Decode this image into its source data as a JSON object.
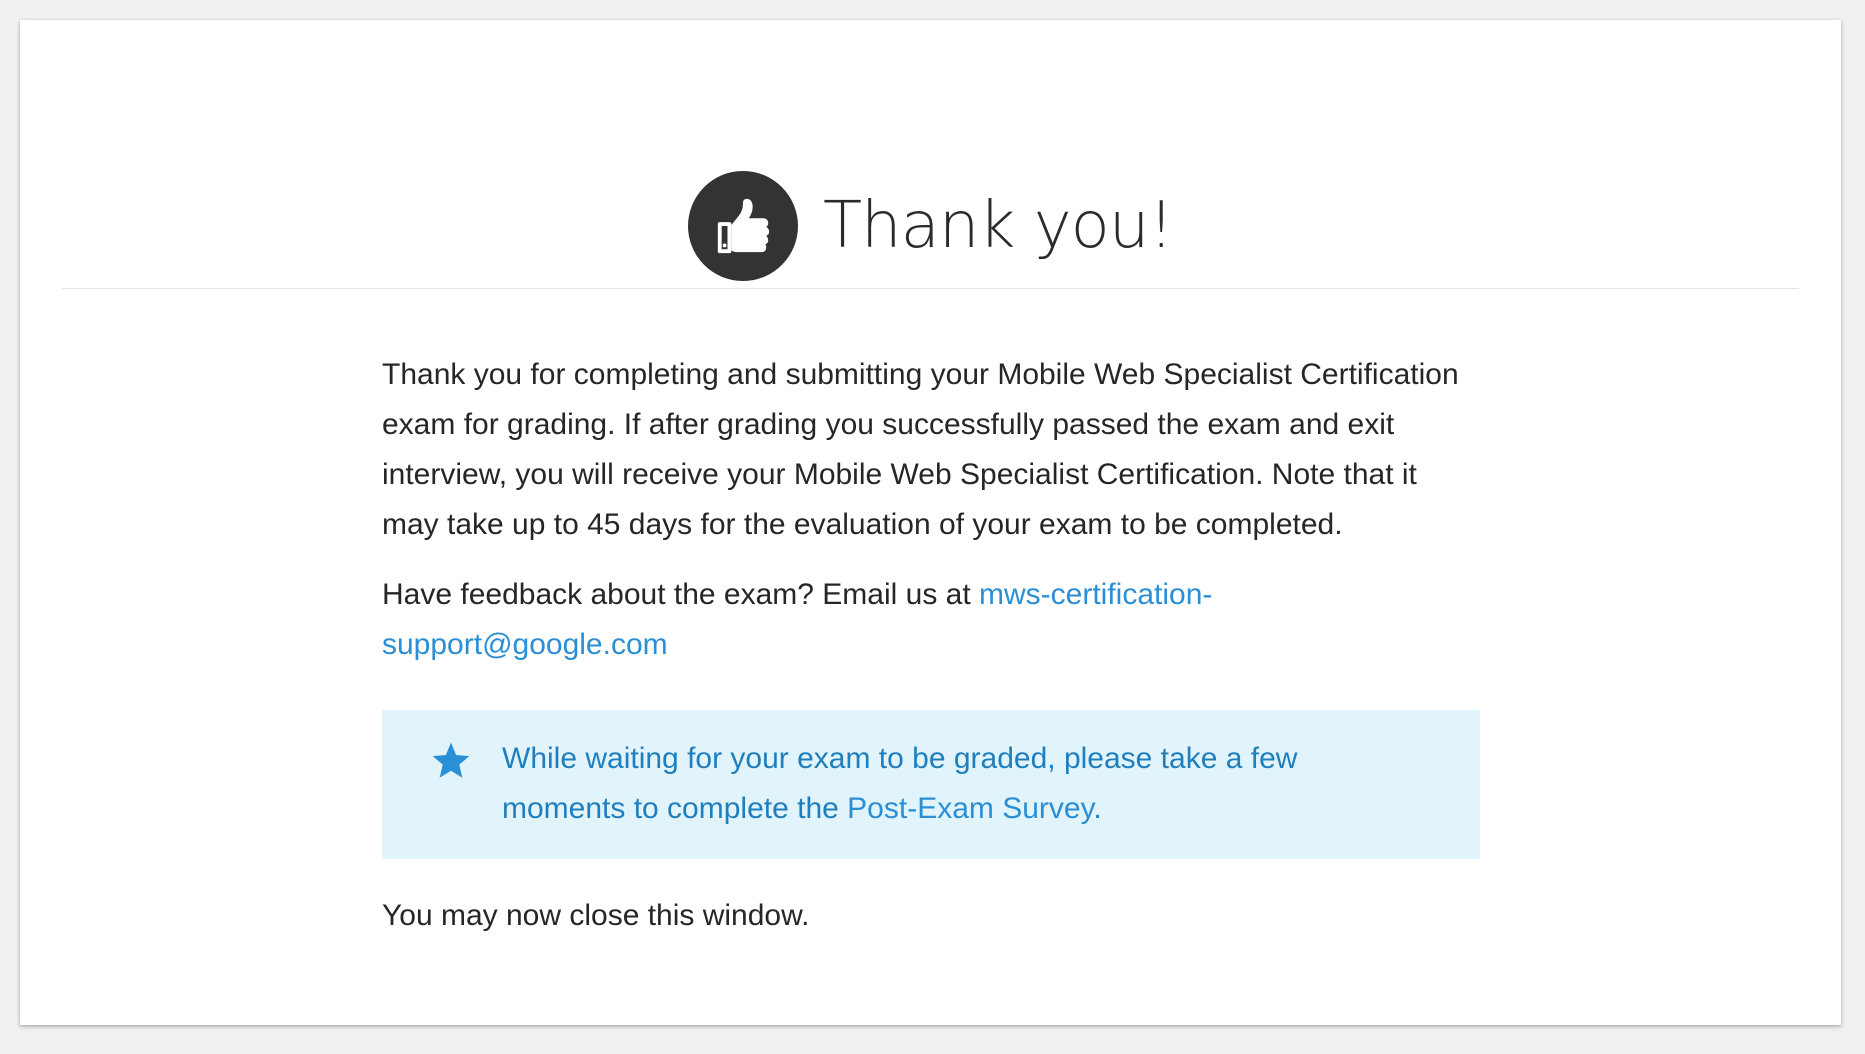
{
  "header": {
    "icon": "thumbs-up-icon",
    "title": "Thank you!"
  },
  "content": {
    "intro": "Thank you for completing and submitting your Mobile Web Specialist Certification exam for grading. If after grading you successfully passed the exam and exit interview, you will receive your Mobile Web Specialist Certification. Note that it may take up to 45 days for the evaluation of your exam to be completed.",
    "feedback_prefix": "Have feedback about the exam? Email us at ",
    "feedback_email": "mws-certification-support@google.com",
    "notice": {
      "icon": "star-icon",
      "text_before": "While waiting for your exam to be graded, please take a few moments to complete the ",
      "survey_link": "Post-Exam Survey",
      "text_after": "."
    },
    "close_message": "You may now close this window."
  },
  "colors": {
    "page_background": "#f1f1f1",
    "card_background": "#ffffff",
    "icon_circle": "#333333",
    "link": "#2a8fd6",
    "notice_background": "#e1f3fb",
    "notice_text": "#1f7fbe"
  }
}
